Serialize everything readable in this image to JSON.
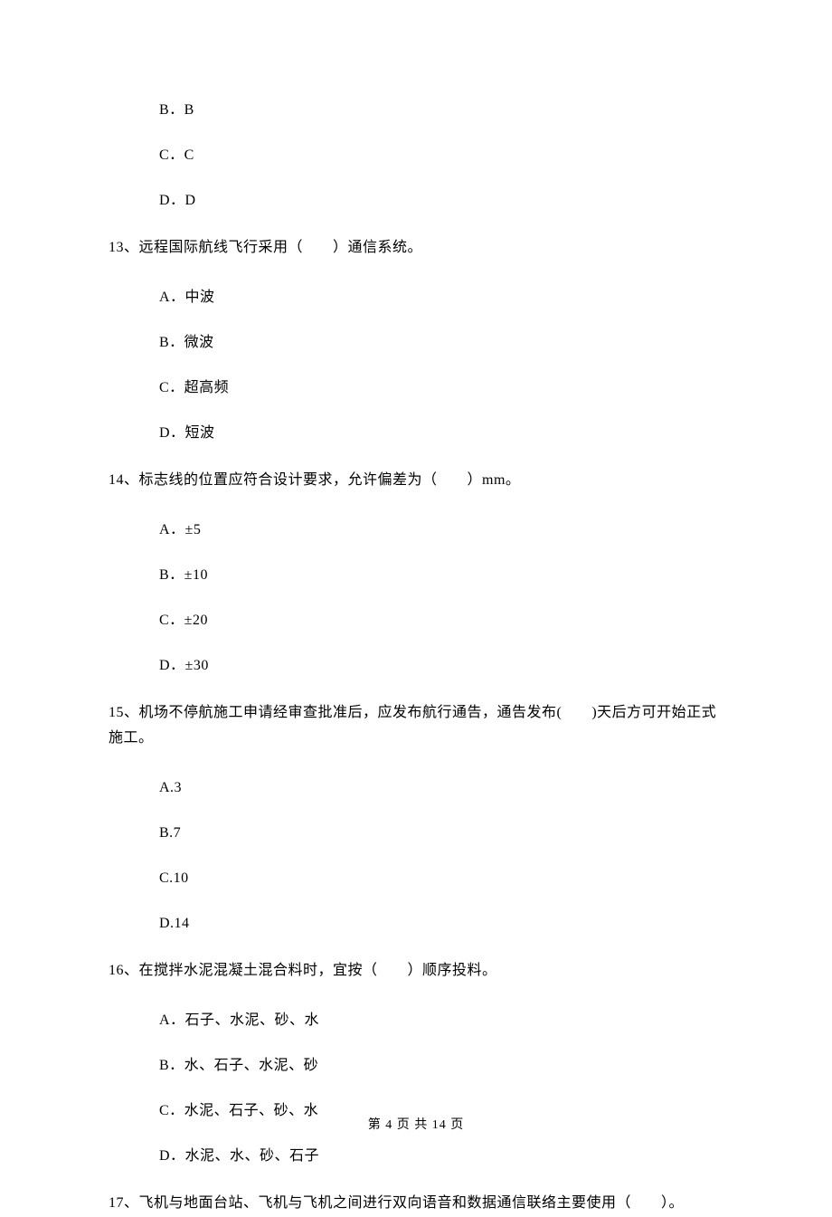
{
  "q12_options": {
    "b": "B．B",
    "c": "C．C",
    "d": "D．D"
  },
  "q13": {
    "stem": "13、远程国际航线飞行采用（　　）通信系统。",
    "a": "A．中波",
    "b": "B．微波",
    "c": "C．超高频",
    "d": "D．短波"
  },
  "q14": {
    "stem": "14、标志线的位置应符合设计要求，允许偏差为（　　）mm。",
    "a": "A．±5",
    "b": "B．±10",
    "c": "C．±20",
    "d": "D．±30"
  },
  "q15": {
    "stem": "15、机场不停航施工申请经审查批准后，应发布航行通告，通告发布(　　)天后方可开始正式施工。",
    "a": "A.3",
    "b": "B.7",
    "c": "C.10",
    "d": "D.14"
  },
  "q16": {
    "stem": "16、在搅拌水泥混凝土混合料时，宜按（　　）顺序投料。",
    "a": "A．石子、水泥、砂、水",
    "b": "B．水、石子、水泥、砂",
    "c": "C．水泥、石子、砂、水",
    "d": "D．水泥、水、砂、石子"
  },
  "q17": {
    "stem": "17、飞机与地面台站、飞机与飞机之间进行双向语音和数据通信联络主要使用（　　）。"
  },
  "footer": "第 4 页 共 14 页"
}
